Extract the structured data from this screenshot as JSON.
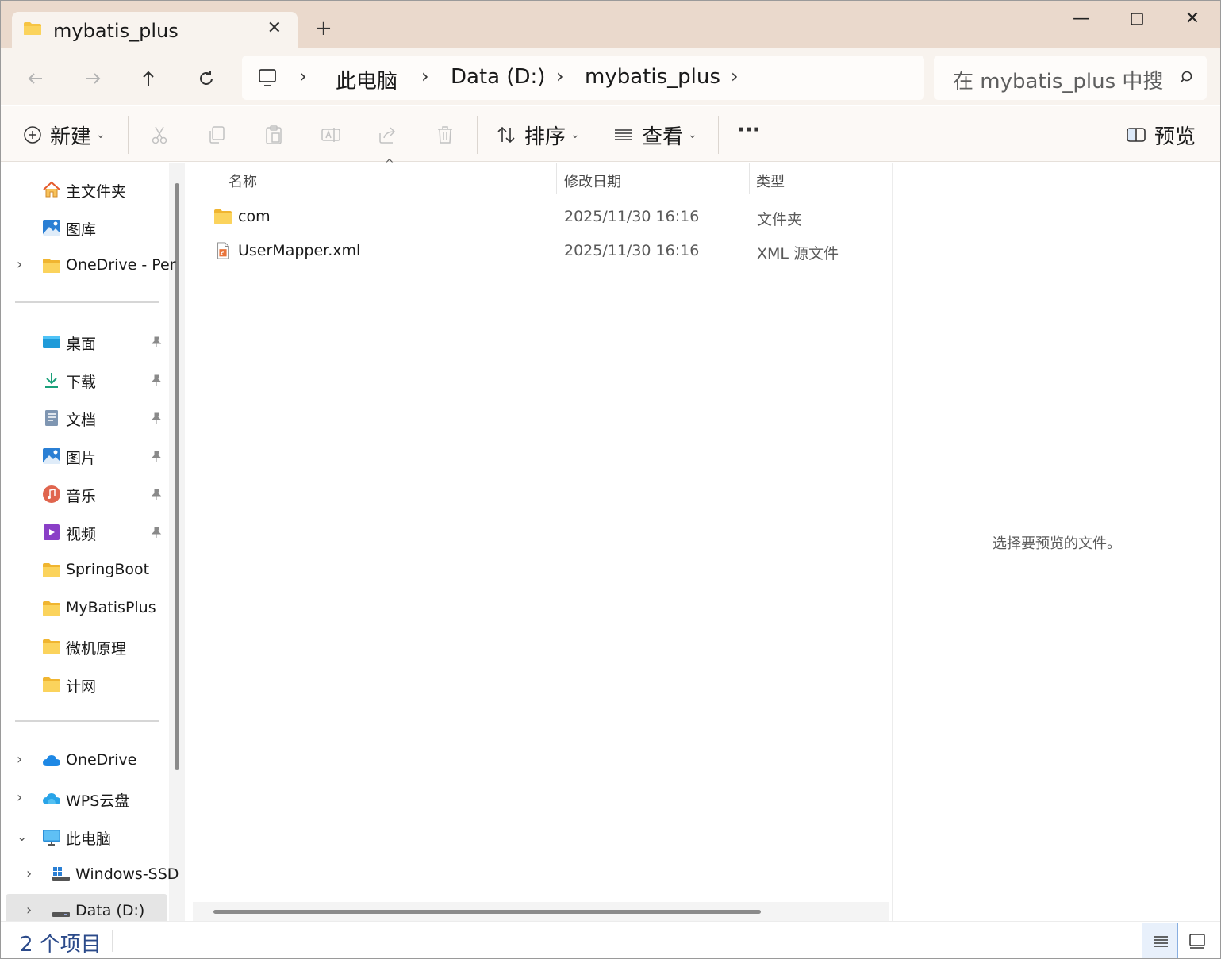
{
  "tab": {
    "title": "mybatis_plus",
    "close": "✕",
    "new_tab": "+"
  },
  "window_controls": {
    "minimize": "—",
    "maximize": "☐",
    "close": "✕"
  },
  "nav": {
    "breadcrumb": [
      "此电脑",
      "Data (D:)",
      "mybatis_plus"
    ],
    "search_placeholder": "在 mybatis_plus 中搜"
  },
  "toolbar": {
    "new_label": "新建",
    "sort_label": "排序",
    "view_label": "查看",
    "more_label": "···",
    "preview_label": "预览"
  },
  "sidebar": {
    "top": [
      {
        "label": "主文件夹",
        "icon": "home-icon"
      },
      {
        "label": "图库",
        "icon": "gallery-icon"
      },
      {
        "label": "OneDrive - Per",
        "icon": "folder-icon",
        "expandable": true
      }
    ],
    "quick": [
      {
        "label": "桌面",
        "icon": "desktop-icon",
        "pinned": true
      },
      {
        "label": "下载",
        "icon": "download-icon",
        "pinned": true
      },
      {
        "label": "文档",
        "icon": "document-icon",
        "pinned": true
      },
      {
        "label": "图片",
        "icon": "pictures-icon",
        "pinned": true
      },
      {
        "label": "音乐",
        "icon": "music-icon",
        "pinned": true
      },
      {
        "label": "视频",
        "icon": "video-icon",
        "pinned": true
      },
      {
        "label": "SpringBoot",
        "icon": "folder-icon"
      },
      {
        "label": "MyBatisPlus",
        "icon": "folder-icon"
      },
      {
        "label": "微机原理",
        "icon": "folder-icon"
      },
      {
        "label": "计网",
        "icon": "folder-icon"
      }
    ],
    "bottom": [
      {
        "label": "OneDrive",
        "icon": "cloud-icon"
      },
      {
        "label": "WPS云盘",
        "icon": "cloud-icon"
      },
      {
        "label": "此电脑",
        "icon": "computer-icon"
      },
      {
        "label": "Windows-SSD",
        "icon": "drive-icon"
      },
      {
        "label": "Data (D:)",
        "icon": "drive-icon"
      }
    ]
  },
  "columns": {
    "name": "名称",
    "date": "修改日期",
    "type": "类型"
  },
  "files": [
    {
      "name": "com",
      "date": "2025/11/30 16:16",
      "type": "文件夹",
      "icon": "folder-icon"
    },
    {
      "name": "UserMapper.xml",
      "date": "2025/11/30 16:16",
      "type": "XML 源文件",
      "icon": "xml-file-icon"
    }
  ],
  "preview_message": "选择要预览的文件。",
  "status": {
    "item_count": "2 个项目"
  },
  "colors": {
    "accent": "#0067c0",
    "folder": "#f6c443",
    "titlebar": "#ead9cc"
  }
}
